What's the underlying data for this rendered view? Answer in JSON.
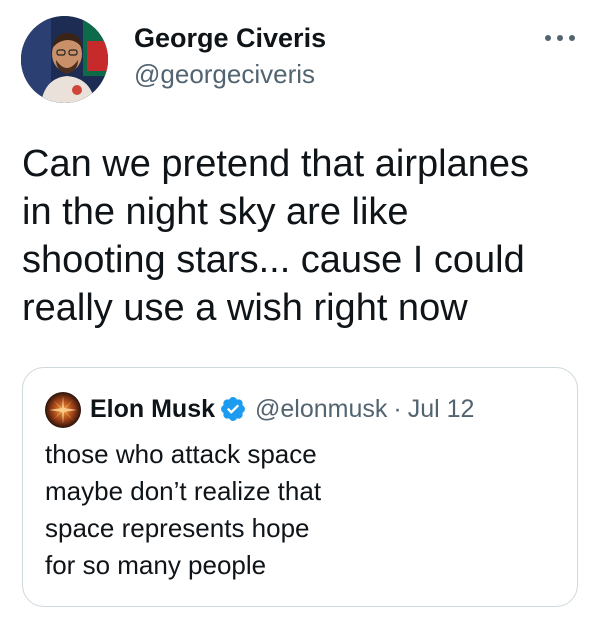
{
  "author": {
    "display_name": "George Civeris",
    "handle": "@georgeciveris",
    "avatar": "profile-photo"
  },
  "more_icon": "ellipsis-icon",
  "tweet_text": "Can we pretend that airplanes\nin the night sky are like\nshooting stars... cause I could\nreally use a wish right now",
  "quote": {
    "author_name": "Elon Musk",
    "verified": true,
    "verified_icon": "verified-badge-icon",
    "handle": "@elonmusk",
    "separator": "·",
    "date": "Jul 12",
    "text": "those who attack space\nmaybe don’t realize that\nspace represents hope\nfor so many people"
  },
  "colors": {
    "text": "#0f1419",
    "secondary": "#536471",
    "border": "#cfd9de",
    "verified_blue": "#1d9bf0"
  }
}
